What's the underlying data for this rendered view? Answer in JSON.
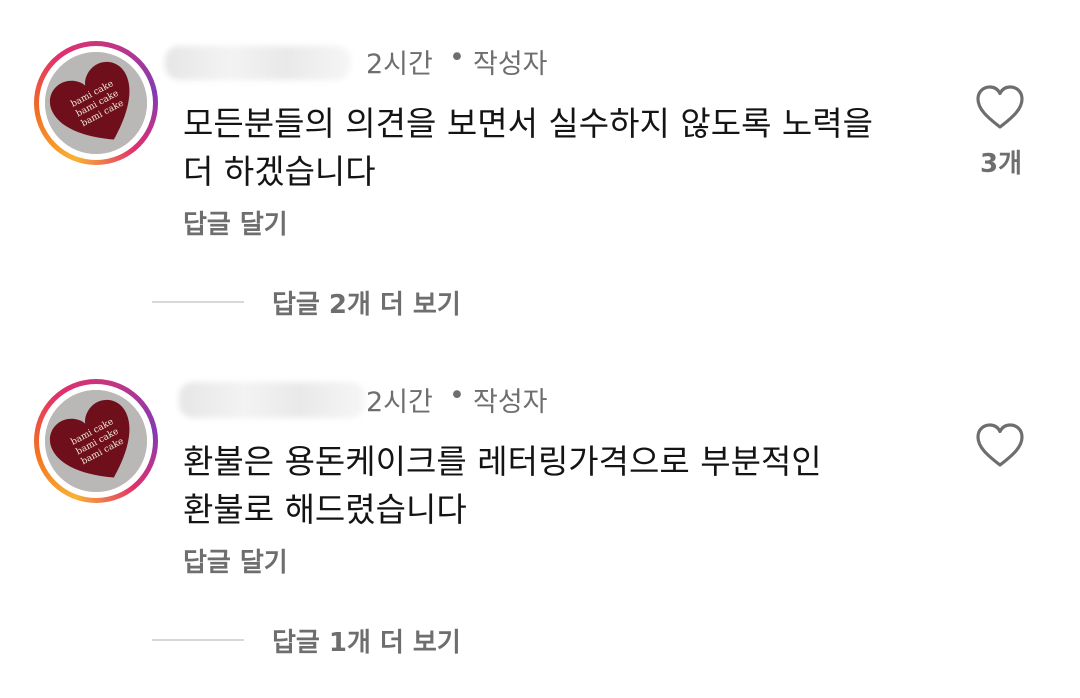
{
  "comments": [
    {
      "username": "[blurred]",
      "time": "2시간",
      "separator": "•",
      "author_badge": "작성자",
      "text_line1": "모든분들의 의견을 보면서 실수하지 않도록 노력을",
      "text_line2": "더 하겠습니다",
      "reply_label": "답글 달기",
      "likes": "3개",
      "view_replies_label": "답글 2개 더 보기"
    },
    {
      "username": "[blurred]",
      "time": "2시간",
      "separator": "•",
      "author_badge": "작성자",
      "text_line1": "환불은 용돈케이크를 레터링가격으로 부분적인",
      "text_line2": "환불로 해드렸습니다",
      "reply_label": "답글 달기",
      "likes": "",
      "view_replies_label": "답글 1개 더 보기"
    }
  ],
  "avatar": {
    "cake_text": "bami cake",
    "colors": {
      "ring": [
        "#f9b233",
        "#e1306c",
        "#833ab4"
      ],
      "heart": "#6f0f1b",
      "background": "#b9b8b6"
    }
  },
  "icons": {
    "like": "heart-outline-icon"
  },
  "colors": {
    "secondary_text": "#6e6e6e",
    "primary_text": "#141414"
  }
}
